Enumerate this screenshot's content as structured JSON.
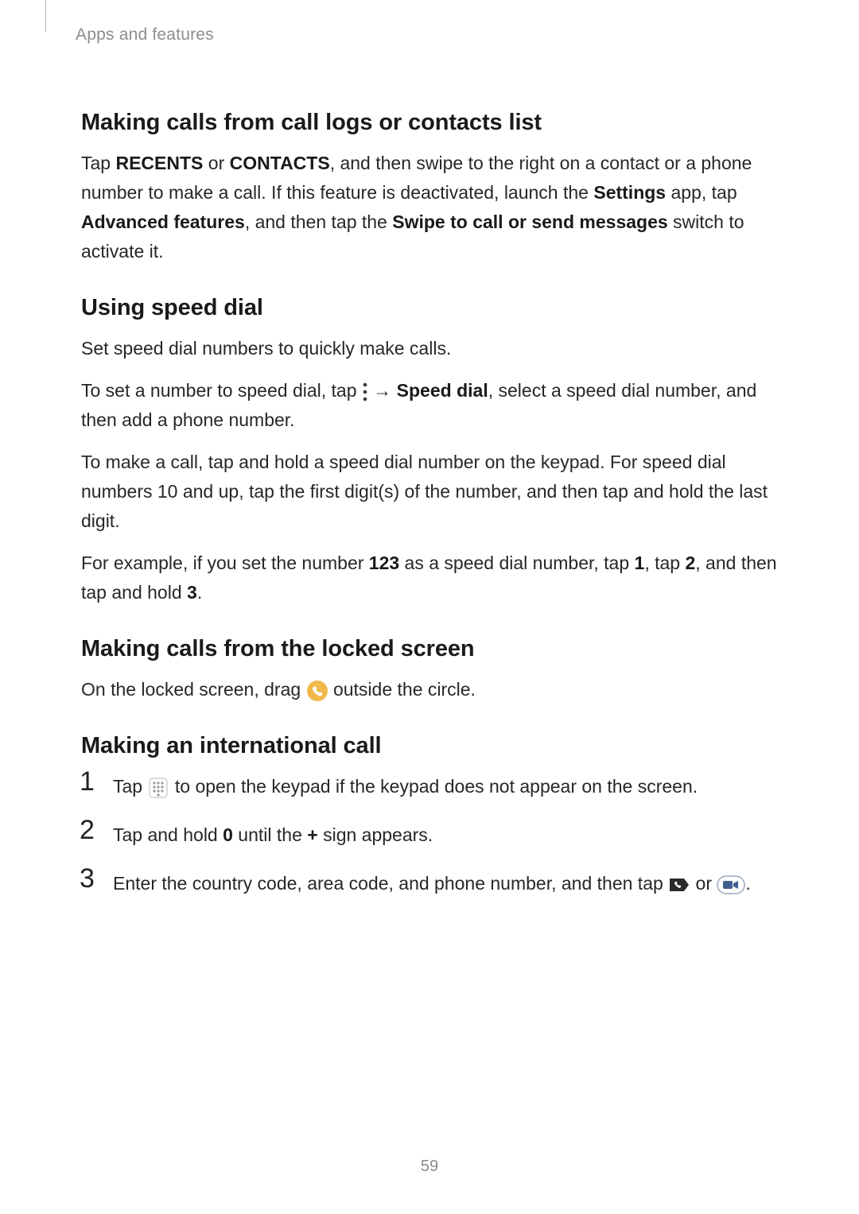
{
  "header": {
    "breadcrumb": "Apps and features"
  },
  "page_number": "59",
  "sections": {
    "call_logs": {
      "heading": "Making calls from call logs or contacts list",
      "p1a": "Tap ",
      "p1b_bold": "RECENTS",
      "p1c": " or ",
      "p1d_bold": "CONTACTS",
      "p1e": ", and then swipe to the right on a contact or a phone number to make a call. If this feature is deactivated, launch the ",
      "p1f_bold": "Settings",
      "p1g": " app, tap ",
      "p1h_bold": "Advanced features",
      "p1i": ", and then tap the ",
      "p1j_bold": "Swipe to call or send messages",
      "p1k": " switch to activate it."
    },
    "speed_dial": {
      "heading": "Using speed dial",
      "p1": "Set speed dial numbers to quickly make calls.",
      "p2a": "To set a number to speed dial, tap ",
      "p2b_arrow": "→",
      "p2c_bold": "Speed dial",
      "p2d": ", select a speed dial number, and then add a phone number.",
      "p3": "To make a call, tap and hold a speed dial number on the keypad. For speed dial numbers 10 and up, tap the first digit(s) of the number, and then tap and hold the last digit.",
      "p4a": "For example, if you set the number ",
      "p4b_bold": "123",
      "p4c": " as a speed dial number, tap ",
      "p4d_bold": "1",
      "p4e": ", tap ",
      "p4f_bold": "2",
      "p4g": ", and then tap and hold ",
      "p4h_bold": "3",
      "p4i": "."
    },
    "locked_screen": {
      "heading": "Making calls from the locked screen",
      "p1a": "On the locked screen, drag ",
      "p1b": " outside the circle."
    },
    "international": {
      "heading": "Making an international call",
      "steps": [
        {
          "num": "1",
          "a": "Tap ",
          "b": " to open the keypad if the keypad does not appear on the screen."
        },
        {
          "num": "2",
          "a": "Tap and hold ",
          "b_bold": "0",
          "c": " until the ",
          "d_bold": "+",
          "e": " sign appears."
        },
        {
          "num": "3",
          "a": "Enter the country code, area code, and phone number, and then tap ",
          "b": " or ",
          "c": "."
        }
      ]
    }
  }
}
